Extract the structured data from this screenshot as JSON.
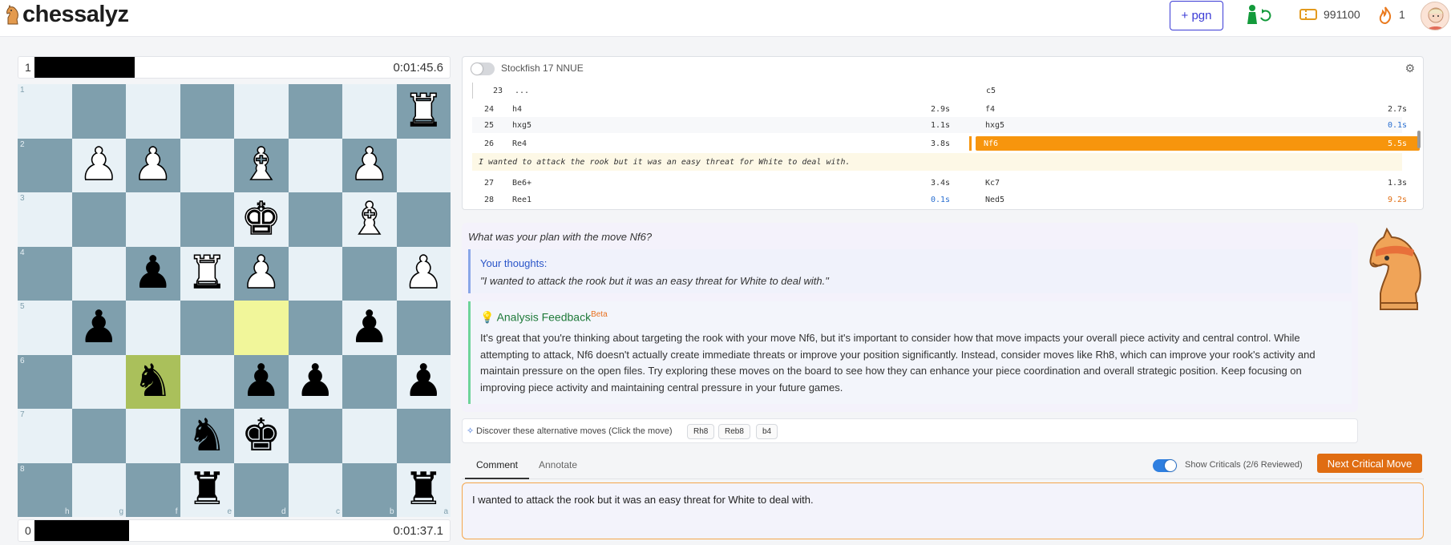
{
  "app": {
    "name": "chessalyz",
    "pgn_button": "+ pgn",
    "tickets": "991100",
    "streak": "1"
  },
  "players": {
    "top": {
      "score": "1",
      "clock": "0:01:45.6"
    },
    "bottom": {
      "score": "0",
      "clock": "0:01:37.1"
    }
  },
  "board": {
    "orientation": "black",
    "rank_labels": [
      "1",
      "2",
      "3",
      "4",
      "5",
      "6",
      "7",
      "8"
    ],
    "file_labels": [
      "h",
      "g",
      "f",
      "e",
      "d",
      "c",
      "b",
      "a"
    ],
    "squares": [
      [
        "",
        "",
        "",
        "",
        "",
        "",
        "",
        "wR"
      ],
      [
        "",
        "wP",
        "wP",
        "",
        "wB",
        "",
        "wP",
        ""
      ],
      [
        "",
        "",
        "",
        "",
        "wK",
        "",
        "wB",
        ""
      ],
      [
        "",
        "",
        "bP",
        "wR",
        "wP",
        "",
        "",
        "wP"
      ],
      [
        "",
        "bP",
        "",
        "",
        "",
        "",
        "bP",
        ""
      ],
      [
        "",
        "",
        "bN",
        "",
        "bP",
        "bP",
        "",
        "bP"
      ],
      [
        "",
        "",
        "",
        "bN",
        "bK",
        "",
        "",
        ""
      ],
      [
        "",
        "",
        "",
        "bR",
        "",
        "",
        "",
        "bR"
      ]
    ],
    "highlight_yellow": [
      4,
      4
    ],
    "highlight_green": [
      5,
      2
    ]
  },
  "engine": {
    "label": "Stockfish 17 NNUE",
    "enabled": false
  },
  "moves": {
    "header": {
      "num": "23",
      "white": "...",
      "black": "c5"
    },
    "rows": [
      {
        "num": "24",
        "white": "h4",
        "white_time": "2.9s",
        "black": "f4",
        "black_time": "2.7s"
      },
      {
        "num": "25",
        "white": "hxg5",
        "white_time": "1.1s",
        "black": "hxg5",
        "black_time": "0.1s"
      },
      {
        "num": "26",
        "white": "Re4",
        "white_time": "3.8s",
        "black": "Nf6",
        "black_time": "5.5s"
      },
      {
        "num": "27",
        "white": "Be6+",
        "white_time": "3.4s",
        "black": "Kc7",
        "black_time": "1.3s"
      },
      {
        "num": "28",
        "white": "Ree1",
        "white_time": "0.1s",
        "black": "Ned5",
        "black_time": "9.2s"
      }
    ],
    "inline_comment": "I wanted to attack the rook but it was an easy threat for White to deal with."
  },
  "feedback": {
    "question": "What was your plan with the move Nf6?",
    "thoughts_heading": "Your thoughts:",
    "thoughts_text": "\"I wanted to attack the rook but it was an easy threat for White to deal with.\"",
    "analysis_heading": "Analysis Feedback",
    "analysis_badge": "Beta",
    "analysis_text": "It's great that you're thinking about targeting the rook with your move Nf6, but it's important to consider how that move impacts your overall piece activity and central control. While attempting to attack, Nf6 doesn't actually create immediate threats or improve your position significantly. Instead, consider moves like Rh8, which can improve your rook's activity and maintain pressure on the open files. Try exploring these moves on the board to see how they can enhance your piece coordination and overall strategic position. Keep focusing on improving piece activity and maintaining central pressure in your future games."
  },
  "alternatives": {
    "label": "Discover these alternative moves (Click the move)",
    "moves": [
      "Rh8",
      "Reb8",
      "b4"
    ]
  },
  "tabs": [
    "Comment",
    "Annotate"
  ],
  "criticals": {
    "label": "Show Criticals (2/6 Reviewed)",
    "enabled": true,
    "next_button": "Next Critical Move"
  },
  "comment_box": {
    "value": "I wanted to attack the rook but it was an easy threat for White to deal with."
  },
  "colors": {
    "accent": "#3b3bd6",
    "critical": "#f7950d",
    "next_button": "#e06d12",
    "board_light": "#e8f1f6",
    "board_dark": "#7f9fad"
  }
}
